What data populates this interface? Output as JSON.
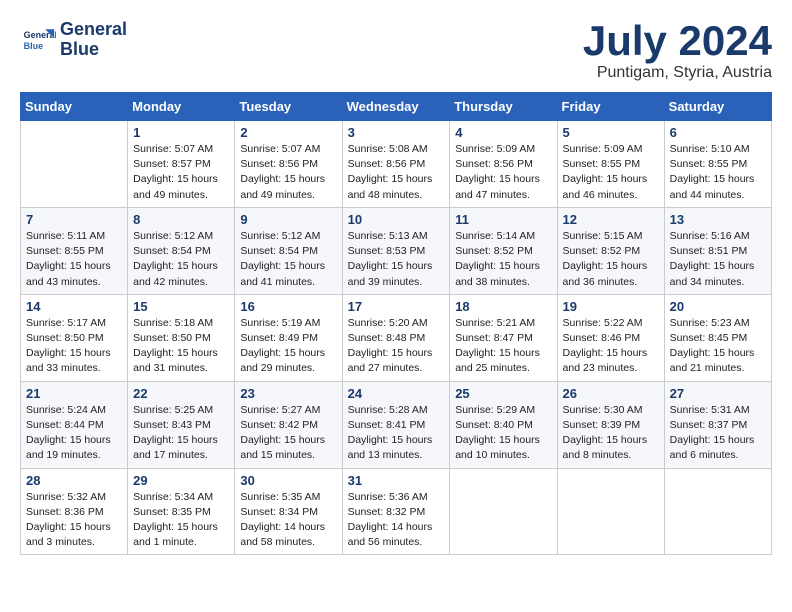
{
  "logo": {
    "line1": "General",
    "line2": "Blue"
  },
  "title": "July 2024",
  "subtitle": "Puntigam, Styria, Austria",
  "weekdays": [
    "Sunday",
    "Monday",
    "Tuesday",
    "Wednesday",
    "Thursday",
    "Friday",
    "Saturday"
  ],
  "weeks": [
    [
      {
        "day": "",
        "info": ""
      },
      {
        "day": "1",
        "info": "Sunrise: 5:07 AM\nSunset: 8:57 PM\nDaylight: 15 hours\nand 49 minutes."
      },
      {
        "day": "2",
        "info": "Sunrise: 5:07 AM\nSunset: 8:56 PM\nDaylight: 15 hours\nand 49 minutes."
      },
      {
        "day": "3",
        "info": "Sunrise: 5:08 AM\nSunset: 8:56 PM\nDaylight: 15 hours\nand 48 minutes."
      },
      {
        "day": "4",
        "info": "Sunrise: 5:09 AM\nSunset: 8:56 PM\nDaylight: 15 hours\nand 47 minutes."
      },
      {
        "day": "5",
        "info": "Sunrise: 5:09 AM\nSunset: 8:55 PM\nDaylight: 15 hours\nand 46 minutes."
      },
      {
        "day": "6",
        "info": "Sunrise: 5:10 AM\nSunset: 8:55 PM\nDaylight: 15 hours\nand 44 minutes."
      }
    ],
    [
      {
        "day": "7",
        "info": "Sunrise: 5:11 AM\nSunset: 8:55 PM\nDaylight: 15 hours\nand 43 minutes."
      },
      {
        "day": "8",
        "info": "Sunrise: 5:12 AM\nSunset: 8:54 PM\nDaylight: 15 hours\nand 42 minutes."
      },
      {
        "day": "9",
        "info": "Sunrise: 5:12 AM\nSunset: 8:54 PM\nDaylight: 15 hours\nand 41 minutes."
      },
      {
        "day": "10",
        "info": "Sunrise: 5:13 AM\nSunset: 8:53 PM\nDaylight: 15 hours\nand 39 minutes."
      },
      {
        "day": "11",
        "info": "Sunrise: 5:14 AM\nSunset: 8:52 PM\nDaylight: 15 hours\nand 38 minutes."
      },
      {
        "day": "12",
        "info": "Sunrise: 5:15 AM\nSunset: 8:52 PM\nDaylight: 15 hours\nand 36 minutes."
      },
      {
        "day": "13",
        "info": "Sunrise: 5:16 AM\nSunset: 8:51 PM\nDaylight: 15 hours\nand 34 minutes."
      }
    ],
    [
      {
        "day": "14",
        "info": "Sunrise: 5:17 AM\nSunset: 8:50 PM\nDaylight: 15 hours\nand 33 minutes."
      },
      {
        "day": "15",
        "info": "Sunrise: 5:18 AM\nSunset: 8:50 PM\nDaylight: 15 hours\nand 31 minutes."
      },
      {
        "day": "16",
        "info": "Sunrise: 5:19 AM\nSunset: 8:49 PM\nDaylight: 15 hours\nand 29 minutes."
      },
      {
        "day": "17",
        "info": "Sunrise: 5:20 AM\nSunset: 8:48 PM\nDaylight: 15 hours\nand 27 minutes."
      },
      {
        "day": "18",
        "info": "Sunrise: 5:21 AM\nSunset: 8:47 PM\nDaylight: 15 hours\nand 25 minutes."
      },
      {
        "day": "19",
        "info": "Sunrise: 5:22 AM\nSunset: 8:46 PM\nDaylight: 15 hours\nand 23 minutes."
      },
      {
        "day": "20",
        "info": "Sunrise: 5:23 AM\nSunset: 8:45 PM\nDaylight: 15 hours\nand 21 minutes."
      }
    ],
    [
      {
        "day": "21",
        "info": "Sunrise: 5:24 AM\nSunset: 8:44 PM\nDaylight: 15 hours\nand 19 minutes."
      },
      {
        "day": "22",
        "info": "Sunrise: 5:25 AM\nSunset: 8:43 PM\nDaylight: 15 hours\nand 17 minutes."
      },
      {
        "day": "23",
        "info": "Sunrise: 5:27 AM\nSunset: 8:42 PM\nDaylight: 15 hours\nand 15 minutes."
      },
      {
        "day": "24",
        "info": "Sunrise: 5:28 AM\nSunset: 8:41 PM\nDaylight: 15 hours\nand 13 minutes."
      },
      {
        "day": "25",
        "info": "Sunrise: 5:29 AM\nSunset: 8:40 PM\nDaylight: 15 hours\nand 10 minutes."
      },
      {
        "day": "26",
        "info": "Sunrise: 5:30 AM\nSunset: 8:39 PM\nDaylight: 15 hours\nand 8 minutes."
      },
      {
        "day": "27",
        "info": "Sunrise: 5:31 AM\nSunset: 8:37 PM\nDaylight: 15 hours\nand 6 minutes."
      }
    ],
    [
      {
        "day": "28",
        "info": "Sunrise: 5:32 AM\nSunset: 8:36 PM\nDaylight: 15 hours\nand 3 minutes."
      },
      {
        "day": "29",
        "info": "Sunrise: 5:34 AM\nSunset: 8:35 PM\nDaylight: 15 hours\nand 1 minute."
      },
      {
        "day": "30",
        "info": "Sunrise: 5:35 AM\nSunset: 8:34 PM\nDaylight: 14 hours\nand 58 minutes."
      },
      {
        "day": "31",
        "info": "Sunrise: 5:36 AM\nSunset: 8:32 PM\nDaylight: 14 hours\nand 56 minutes."
      },
      {
        "day": "",
        "info": ""
      },
      {
        "day": "",
        "info": ""
      },
      {
        "day": "",
        "info": ""
      }
    ]
  ]
}
